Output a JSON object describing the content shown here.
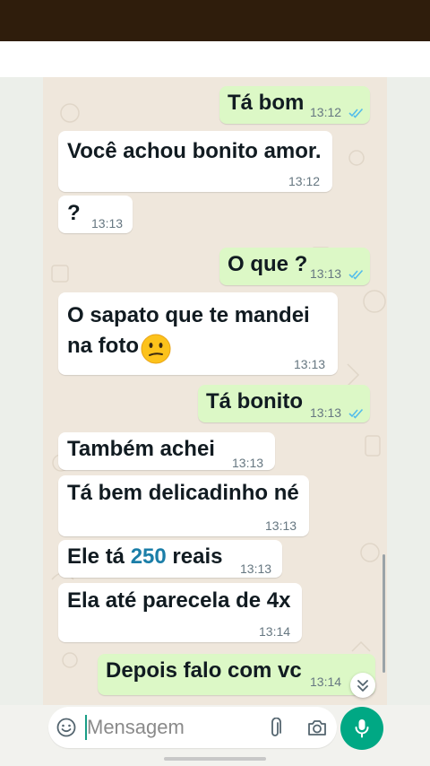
{
  "composer": {
    "placeholder": "Mensagem"
  },
  "messages": [
    {
      "direction": "outgoing",
      "text": "Tá bom",
      "time": "13:12",
      "status": "read"
    },
    {
      "direction": "incoming",
      "text": "Você achou bonito amor.",
      "time": "13:12"
    },
    {
      "direction": "incoming",
      "text": "?",
      "time": "13:13"
    },
    {
      "direction": "outgoing",
      "text": "O que ?",
      "time": "13:13",
      "status": "read"
    },
    {
      "direction": "incoming",
      "lines": [
        "O sapato que te mandei",
        "na foto"
      ],
      "emoji": "confused-face",
      "time": "13:13"
    },
    {
      "direction": "outgoing",
      "text": "Tá bonito",
      "time": "13:13",
      "status": "read"
    },
    {
      "direction": "incoming",
      "text": "Também achei",
      "time": "13:13"
    },
    {
      "direction": "incoming",
      "text": "Tá bem delicadinho né",
      "time": "13:13"
    },
    {
      "direction": "incoming",
      "text_before": "Ele tá ",
      "number": "250",
      "text_after": " reais",
      "time": "13:13"
    },
    {
      "direction": "incoming",
      "text": "Ela até parecela de 4x",
      "time": "13:14"
    },
    {
      "direction": "outgoing",
      "text": "Depois falo com vc",
      "time": "13:14",
      "status": "read"
    }
  ],
  "colors": {
    "incoming_bubble": "#ffffff",
    "outgoing_bubble": "#dcf8c6",
    "read_ticks": "#53bdeb",
    "number_link": "#1b7ea8",
    "send_button": "#00a884",
    "wallpaper": "#efe7dc",
    "top_bar": "#2f1d0c"
  },
  "icons": [
    "emoji-icon",
    "attach-icon",
    "camera-icon",
    "mic-icon",
    "scroll-down-icon"
  ]
}
